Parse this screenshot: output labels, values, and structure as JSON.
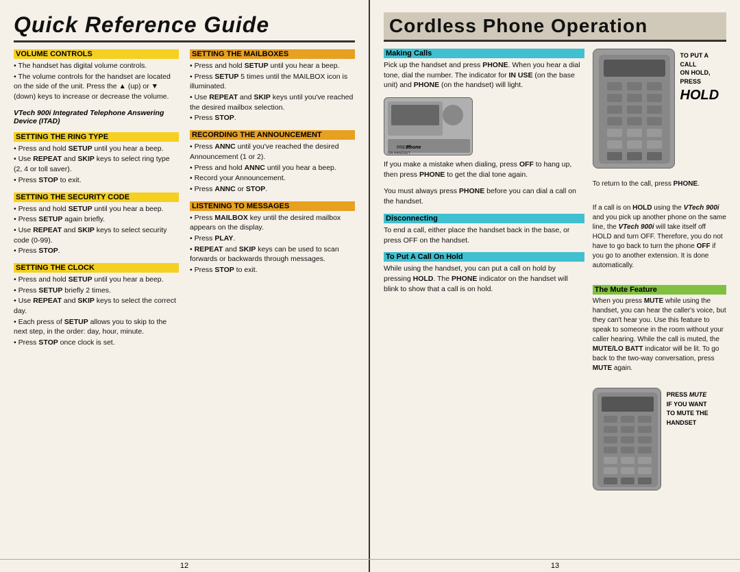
{
  "left": {
    "title": "Quick Reference Guide",
    "sections": {
      "volume_controls": {
        "title": "VOLUME CONTROLS",
        "items": [
          "The handset has digital volume controls.",
          "The volume controls for the handset are located on the side of the unit. Press the ▲ (up) or ▼ (down) keys to increase or decrease the volume."
        ]
      },
      "vtech_info": {
        "text": "VTech 900i Integrated Telephone Answering Device (ITAD)"
      },
      "ring_type": {
        "title": "SETTING THE RING TYPE",
        "items": [
          "Press and hold SETUP until you hear a beep.",
          "Use REPEAT and SKIP keys to select ring type (2, 4 or toll saver).",
          "Press STOP to exit."
        ]
      },
      "security_code": {
        "title": "SETTING THE SECURITY CODE",
        "items": [
          "Press and hold SETUP until you hear a beep.",
          "Press SETUP again briefly.",
          "Use REPEAT and SKIP keys to select security code (0-99).",
          "Press STOP."
        ]
      },
      "clock": {
        "title": "SETTING THE CLOCK",
        "items": [
          "Press and hold SETUP until you hear a beep.",
          "Press SETUP briefly 2 times.",
          "Use REPEAT and SKIP keys to select the correct day.",
          "Each press of SETUP allows you to skip to the next step, in the order: day, hour, minute.",
          "Press STOP once clock is set."
        ]
      },
      "mailboxes": {
        "title": "SETTING THE MAILBOXES",
        "items": [
          "Press and hold SETUP until you hear a beep.",
          "Press SETUP 5 times until the MAILBOX icon is illuminated.",
          "Use REPEAT and SKIP keys until you've reached the desired mailbox selection.",
          "Press STOP."
        ]
      },
      "recording": {
        "title": "RECORDING THE ANNOUNCEMENT",
        "items": [
          "Press ANNC until you've reached the desired Announcement (1 or 2).",
          "Press and hold ANNC until you hear a beep.",
          "Record your Announcement.",
          "Press ANNC or STOP."
        ]
      },
      "listening": {
        "title": "LISTENING TO MESSAGES",
        "items": [
          "Press MAILBOX key until the desired mailbox appears on the display.",
          "Press PLAY.",
          "REPEAT and SKIP keys can be used to scan forwards or backwards through messages.",
          "Press STOP to exit."
        ]
      }
    },
    "page_number": "12"
  },
  "right": {
    "title": "Cordless Phone Operation",
    "sections": {
      "making_calls": {
        "title": "Making Calls",
        "text": "Pick up the handset and press PHONE. When you hear a dial tone, dial the number. The indicator for IN USE (on the base unit) and PHONE (on the handset) will light."
      },
      "phone_label": "PRESS PHONE\nON HANDSET\nFOR MAKING CALL",
      "dialing_error": "If you make a mistake when dialing, press OFF to hang up, then press PHONE to get the dial tone again.",
      "must_press": "You must always press PHONE before you can dial a call on the handset.",
      "disconnecting": {
        "title": "Disconnecting",
        "text": "To end a call, either place the handset back in the base, or press OFF on the handset."
      },
      "call_on_hold": {
        "title": "To Put A Call On Hold",
        "text": "While using the handset, you can put a call on hold by pressing HOLD. The PHONE indicator on the handset will blink to show that a call is on hold."
      },
      "hold_instruction": {
        "title": "TO PUT A CALL\nON HOLD,\nPRESS",
        "hold_word": "HOLD"
      },
      "return_call": "To return to the call, press PHONE.",
      "hold_explanation": "If a call is on HOLD using the VTech 900i and you pick up another phone on the same line, the VTech 900i will take itself off HOLD and turn OFF. Therefore, you do not have to go back to turn the phone OFF if you go to another extension. It is done automatically.",
      "mute_feature": {
        "title": "The Mute Feature",
        "text": "When you press MUTE while using the handset, you can hear the caller's voice, but they can't hear you. Use this feature to speak to someone in the room without your caller hearing. While the call is muted, the MUTE/LO BATT indicator will be lit. To go back to the two-way conversation, press MUTE again."
      },
      "mute_label": "PRESS MUTE\nIF YOU WANT\nTO MUTE THE\nHANDSET"
    },
    "page_number": "13"
  }
}
